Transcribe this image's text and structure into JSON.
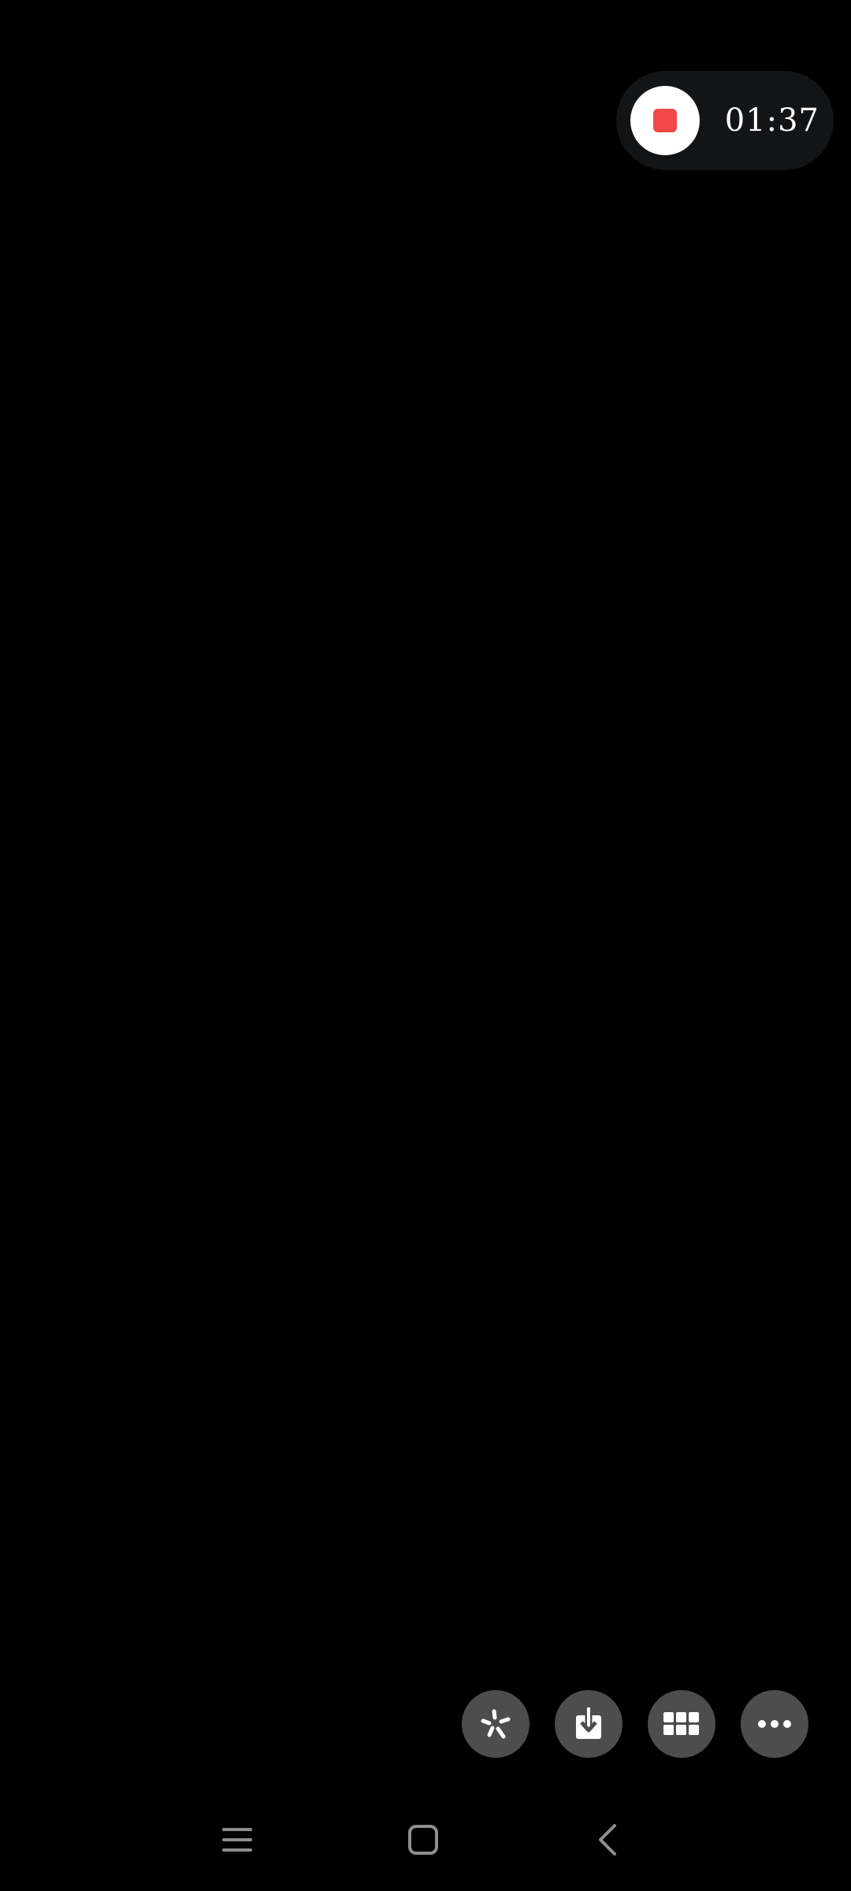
{
  "recorder": {
    "timer": "01:37",
    "stop_icon": "stop-icon",
    "accent_color": "#f24848",
    "pill_color": "#131416"
  },
  "toolbar": {
    "button_color": "#4d4d4d",
    "buttons": [
      {
        "name": "sparkle-icon"
      },
      {
        "name": "download-icon"
      },
      {
        "name": "grid-icon"
      },
      {
        "name": "more-icon"
      }
    ]
  },
  "nav": {
    "items": [
      {
        "name": "recent-apps-icon"
      },
      {
        "name": "home-icon"
      },
      {
        "name": "back-icon"
      }
    ]
  }
}
